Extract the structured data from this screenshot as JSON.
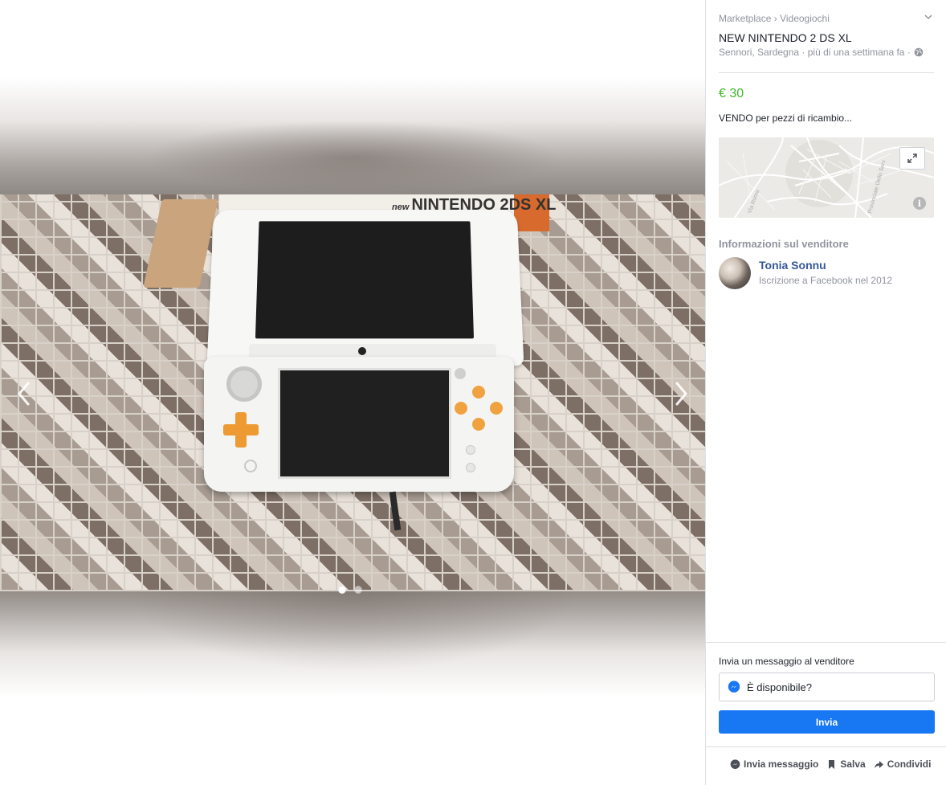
{
  "breadcrumb": {
    "root": "Marketplace",
    "separator": "›",
    "category": "Videogiochi"
  },
  "listing": {
    "title": "NEW NINTENDO 2 DS XL",
    "location": "Sennori, Sardegna · più di una settimana fa ·",
    "price": "€ 30",
    "description": "VENDO per pezzi di ricambio..."
  },
  "photo_box": {
    "brand": "new",
    "model": "NINTENDO 2DS XL"
  },
  "map": {
    "labels": [
      "Via Roma",
      "Provinciale Dello Serv"
    ]
  },
  "seller": {
    "heading": "Informazioni sul venditore",
    "name": "Tonia Sonnu",
    "since": "Iscrizione a Facebook nel 2012"
  },
  "message": {
    "label": "Invia un messaggio al venditore",
    "value": "È disponibile?",
    "send_label": "Invia"
  },
  "footer": {
    "message_label": "Invia messaggio",
    "save_label": "Salva",
    "share_label": "Condividi"
  },
  "gallery": {
    "count": 2,
    "active": 1
  },
  "colors": {
    "price": "#42b72a",
    "link": "#365899",
    "primary_button": "#1877f2",
    "ds_accent": "#ee9a32"
  }
}
